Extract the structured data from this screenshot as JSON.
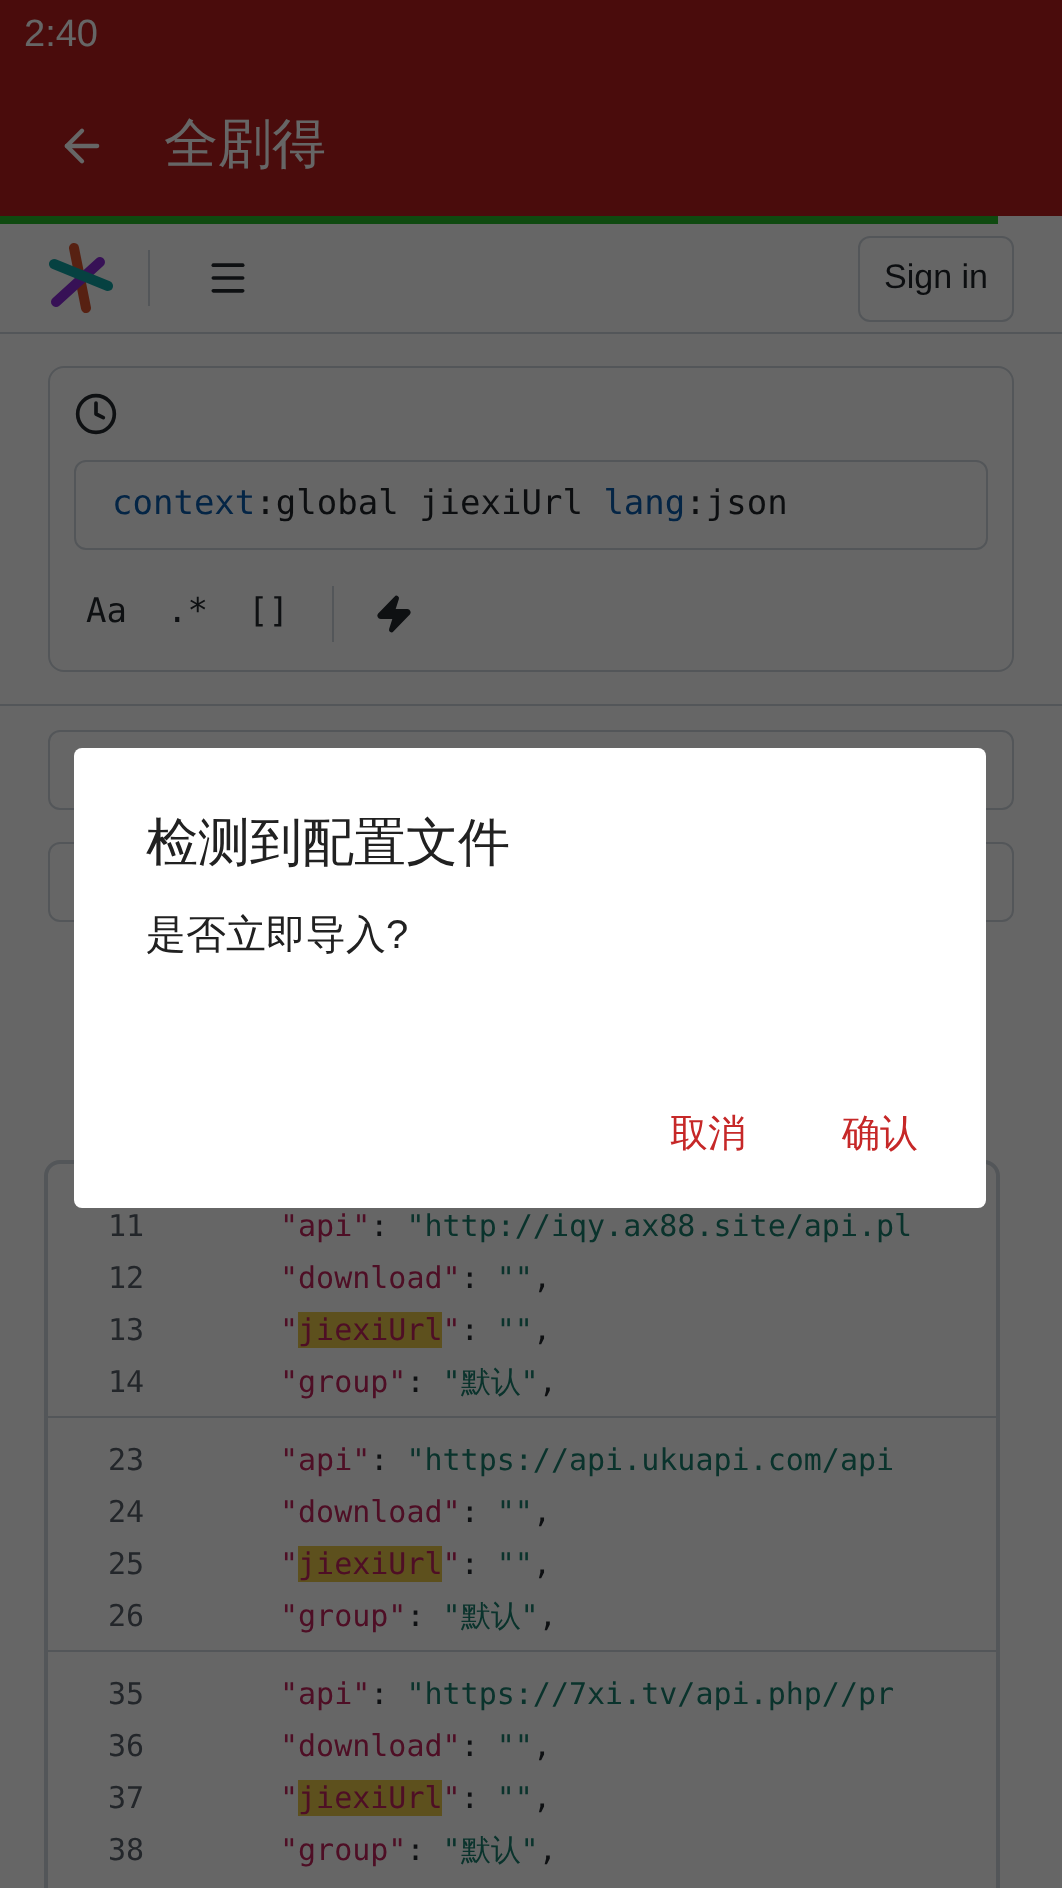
{
  "status_bar": {
    "time": "2:40"
  },
  "app_bar": {
    "title": "全剧得"
  },
  "page_progress": {
    "level": 0.94
  },
  "header": {
    "sign_in": "Sign in"
  },
  "search": {
    "query": [
      {
        "text": "context",
        "kind": "filter"
      },
      {
        "text": ":",
        "kind": "plain"
      },
      {
        "text": "global",
        "kind": "plain"
      },
      {
        "text": " jiexiUrl ",
        "kind": "plain"
      },
      {
        "text": "lang",
        "kind": "filter"
      },
      {
        "text": ":",
        "kind": "plain"
      },
      {
        "text": "json",
        "kind": "plain"
      }
    ],
    "options": [
      {
        "label": "Aa"
      },
      {
        "label": ".*"
      },
      {
        "label": "[]"
      }
    ]
  },
  "code": {
    "blocks": [
      [
        {
          "number": "11",
          "tokens": [
            {
              "text": "\"api\"",
              "kind": "key"
            },
            {
              "text": ": ",
              "kind": "punct"
            },
            {
              "text": "\"http://iqy.ax88.site/api.pl",
              "kind": "string"
            }
          ]
        },
        {
          "number": "12",
          "tokens": [
            {
              "text": "\"download\"",
              "kind": "key"
            },
            {
              "text": ": ",
              "kind": "punct"
            },
            {
              "text": "\"\"",
              "kind": "string"
            },
            {
              "text": ",",
              "kind": "punct"
            }
          ]
        },
        {
          "number": "13",
          "tokens": [
            {
              "text": "\"",
              "kind": "key"
            },
            {
              "text": "jiexiUrl",
              "kind": "match"
            },
            {
              "text": "\"",
              "kind": "key"
            },
            {
              "text": ": ",
              "kind": "punct"
            },
            {
              "text": "\"\"",
              "kind": "string"
            },
            {
              "text": ",",
              "kind": "punct"
            }
          ]
        },
        {
          "number": "14",
          "tokens": [
            {
              "text": "\"group\"",
              "kind": "key"
            },
            {
              "text": ": ",
              "kind": "punct"
            },
            {
              "text": "\"默认\"",
              "kind": "string"
            },
            {
              "text": ",",
              "kind": "punct"
            }
          ]
        }
      ],
      [
        {
          "number": "23",
          "tokens": [
            {
              "text": "\"api\"",
              "kind": "key"
            },
            {
              "text": ": ",
              "kind": "punct"
            },
            {
              "text": "\"https://api.ukuapi.com/api",
              "kind": "string"
            }
          ]
        },
        {
          "number": "24",
          "tokens": [
            {
              "text": "\"download\"",
              "kind": "key"
            },
            {
              "text": ": ",
              "kind": "punct"
            },
            {
              "text": "\"\"",
              "kind": "string"
            },
            {
              "text": ",",
              "kind": "punct"
            }
          ]
        },
        {
          "number": "25",
          "tokens": [
            {
              "text": "\"",
              "kind": "key"
            },
            {
              "text": "jiexiUrl",
              "kind": "match"
            },
            {
              "text": "\"",
              "kind": "key"
            },
            {
              "text": ": ",
              "kind": "punct"
            },
            {
              "text": "\"\"",
              "kind": "string"
            },
            {
              "text": ",",
              "kind": "punct"
            }
          ]
        },
        {
          "number": "26",
          "tokens": [
            {
              "text": "\"group\"",
              "kind": "key"
            },
            {
              "text": ": ",
              "kind": "punct"
            },
            {
              "text": "\"默认\"",
              "kind": "string"
            },
            {
              "text": ",",
              "kind": "punct"
            }
          ]
        }
      ],
      [
        {
          "number": "35",
          "tokens": [
            {
              "text": "\"api\"",
              "kind": "key"
            },
            {
              "text": ": ",
              "kind": "punct"
            },
            {
              "text": "\"https://7xi.tv/api.php//pr",
              "kind": "string"
            }
          ]
        },
        {
          "number": "36",
          "tokens": [
            {
              "text": "\"download\"",
              "kind": "key"
            },
            {
              "text": ": ",
              "kind": "punct"
            },
            {
              "text": "\"\"",
              "kind": "string"
            },
            {
              "text": ",",
              "kind": "punct"
            }
          ]
        },
        {
          "number": "37",
          "tokens": [
            {
              "text": "\"",
              "kind": "key"
            },
            {
              "text": "jiexiUrl",
              "kind": "match"
            },
            {
              "text": "\"",
              "kind": "key"
            },
            {
              "text": ": ",
              "kind": "punct"
            },
            {
              "text": "\"\"",
              "kind": "string"
            },
            {
              "text": ",",
              "kind": "punct"
            }
          ]
        },
        {
          "number": "38",
          "tokens": [
            {
              "text": "\"group\"",
              "kind": "key"
            },
            {
              "text": ": ",
              "kind": "punct"
            },
            {
              "text": "\"默认\"",
              "kind": "string"
            },
            {
              "text": ",",
              "kind": "punct"
            }
          ]
        }
      ]
    ]
  },
  "dialog": {
    "title": "检测到配置文件",
    "message": "是否立即导入?",
    "buttons": [
      "取消",
      "确认"
    ]
  }
}
